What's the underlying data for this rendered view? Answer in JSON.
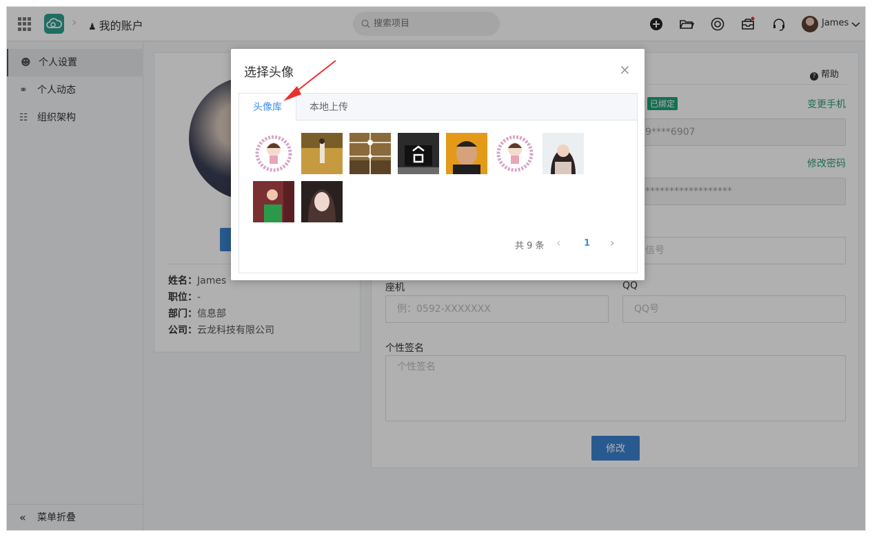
{
  "header": {
    "breadcrumb": "我的账户",
    "search_placeholder": "搜索项目",
    "user_name": "James",
    "icons": [
      "add-circle-icon",
      "folder-open-icon",
      "help-ring-icon",
      "inbox-icon",
      "headset-icon"
    ]
  },
  "sidebar": {
    "items": [
      {
        "label": "个人设置",
        "icon": "user-icon",
        "active": true
      },
      {
        "label": "个人动态",
        "icon": "fire-icon",
        "active": false
      },
      {
        "label": "组织架构",
        "icon": "org-chart-icon",
        "active": false
      }
    ],
    "collapse_label": "菜单折叠"
  },
  "profile_card": {
    "rows": [
      {
        "key": "姓名：",
        "value": "James"
      },
      {
        "key": "职位：",
        "value": "-"
      },
      {
        "key": "部门：",
        "value": "信息部"
      },
      {
        "key": "公司：",
        "value": "云龙科技有限公司"
      }
    ]
  },
  "form": {
    "help_label": "帮助",
    "bound_tag": "已绑定",
    "change_phone": "变更手机",
    "phone_value": "9****6907",
    "change_password": "修改密码",
    "password_value": "******************",
    "wechat_placeholder": "信号",
    "landline_label": "座机",
    "landline_placeholder": "例：0592-XXXXXXX",
    "qq_label": "QQ",
    "qq_placeholder": "QQ号",
    "signature_label": "个性签名",
    "signature_placeholder": "个性签名",
    "submit_label": "修改"
  },
  "modal": {
    "title": "选择头像",
    "tabs": [
      "头像库",
      "本地上传"
    ],
    "active_tab": 0,
    "avatars": [
      "cartoon-girl-wreath",
      "girl-in-field",
      "brown-grid",
      "dark-sign",
      "smiling-man",
      "cartoon-girl-wreath",
      "lace-girl",
      "green-shirt-girl",
      "portrait-woman"
    ],
    "total_label": "共 9 条",
    "current_page": "1"
  },
  "colors": {
    "accent_blue": "#3a83d1",
    "accent_green": "#21a179",
    "tab_blue": "#3a8ee6",
    "annotation_red": "#e8322b"
  }
}
